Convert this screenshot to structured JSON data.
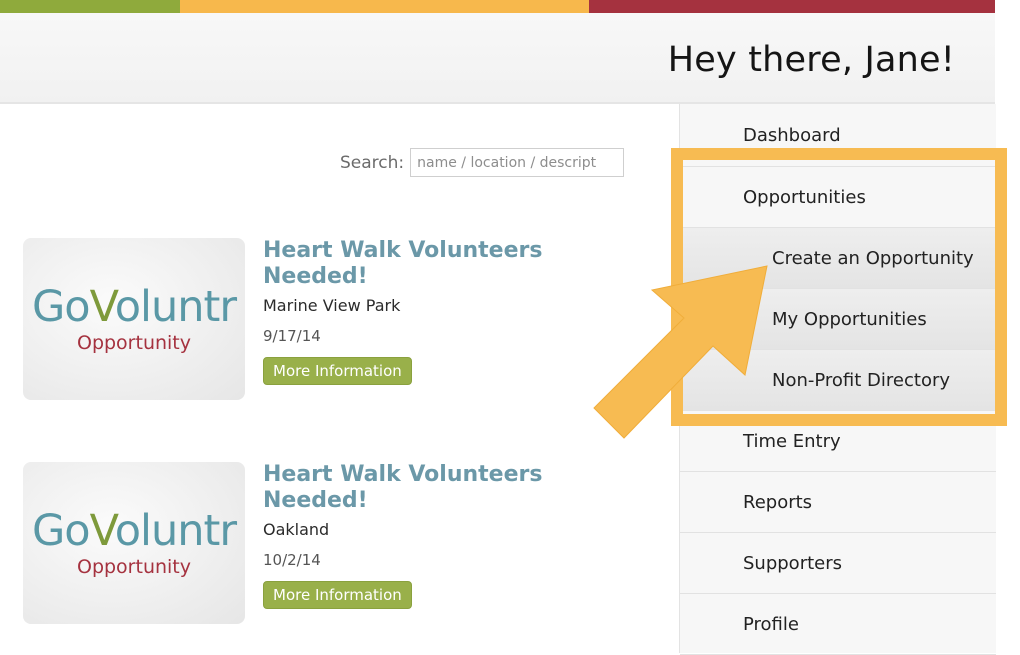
{
  "header": {
    "greeting": "Hey there, Jane!"
  },
  "search": {
    "label": "Search:",
    "placeholder": "name / location / descript"
  },
  "opportunities": [
    {
      "logo": {
        "brand": "GoVoluntr",
        "go": "Go",
        "vol": "V",
        "rest": "oluntr",
        "subtitle": "Opportunity"
      },
      "title": "Heart Walk Volunteers Needed!",
      "location": "Marine View Park",
      "date": "9/17/14",
      "button": "More Information"
    },
    {
      "logo": {
        "brand": "GoVoluntr",
        "go": "Go",
        "vol": "V",
        "rest": "oluntr",
        "subtitle": "Opportunity"
      },
      "title": "Heart Walk Volunteers Needed!",
      "location": "Oakland",
      "date": "10/2/14",
      "button": "More Information"
    }
  ],
  "sidebar": {
    "items": [
      {
        "label": "Dashboard"
      },
      {
        "label": "Opportunities"
      },
      {
        "label": "Create an Opportunity"
      },
      {
        "label": "My Opportunities"
      },
      {
        "label": "Non-Profit Directory"
      },
      {
        "label": "Time Entry"
      },
      {
        "label": "Reports"
      },
      {
        "label": "Supporters"
      },
      {
        "label": "Profile"
      }
    ]
  },
  "colors": {
    "stripe_green": "#8faa3c",
    "stripe_orange": "#f7b84c",
    "stripe_red": "#a5323f",
    "highlight": "#f7bb52",
    "title_blue": "#6b98a8",
    "button_green": "#99b04a"
  }
}
